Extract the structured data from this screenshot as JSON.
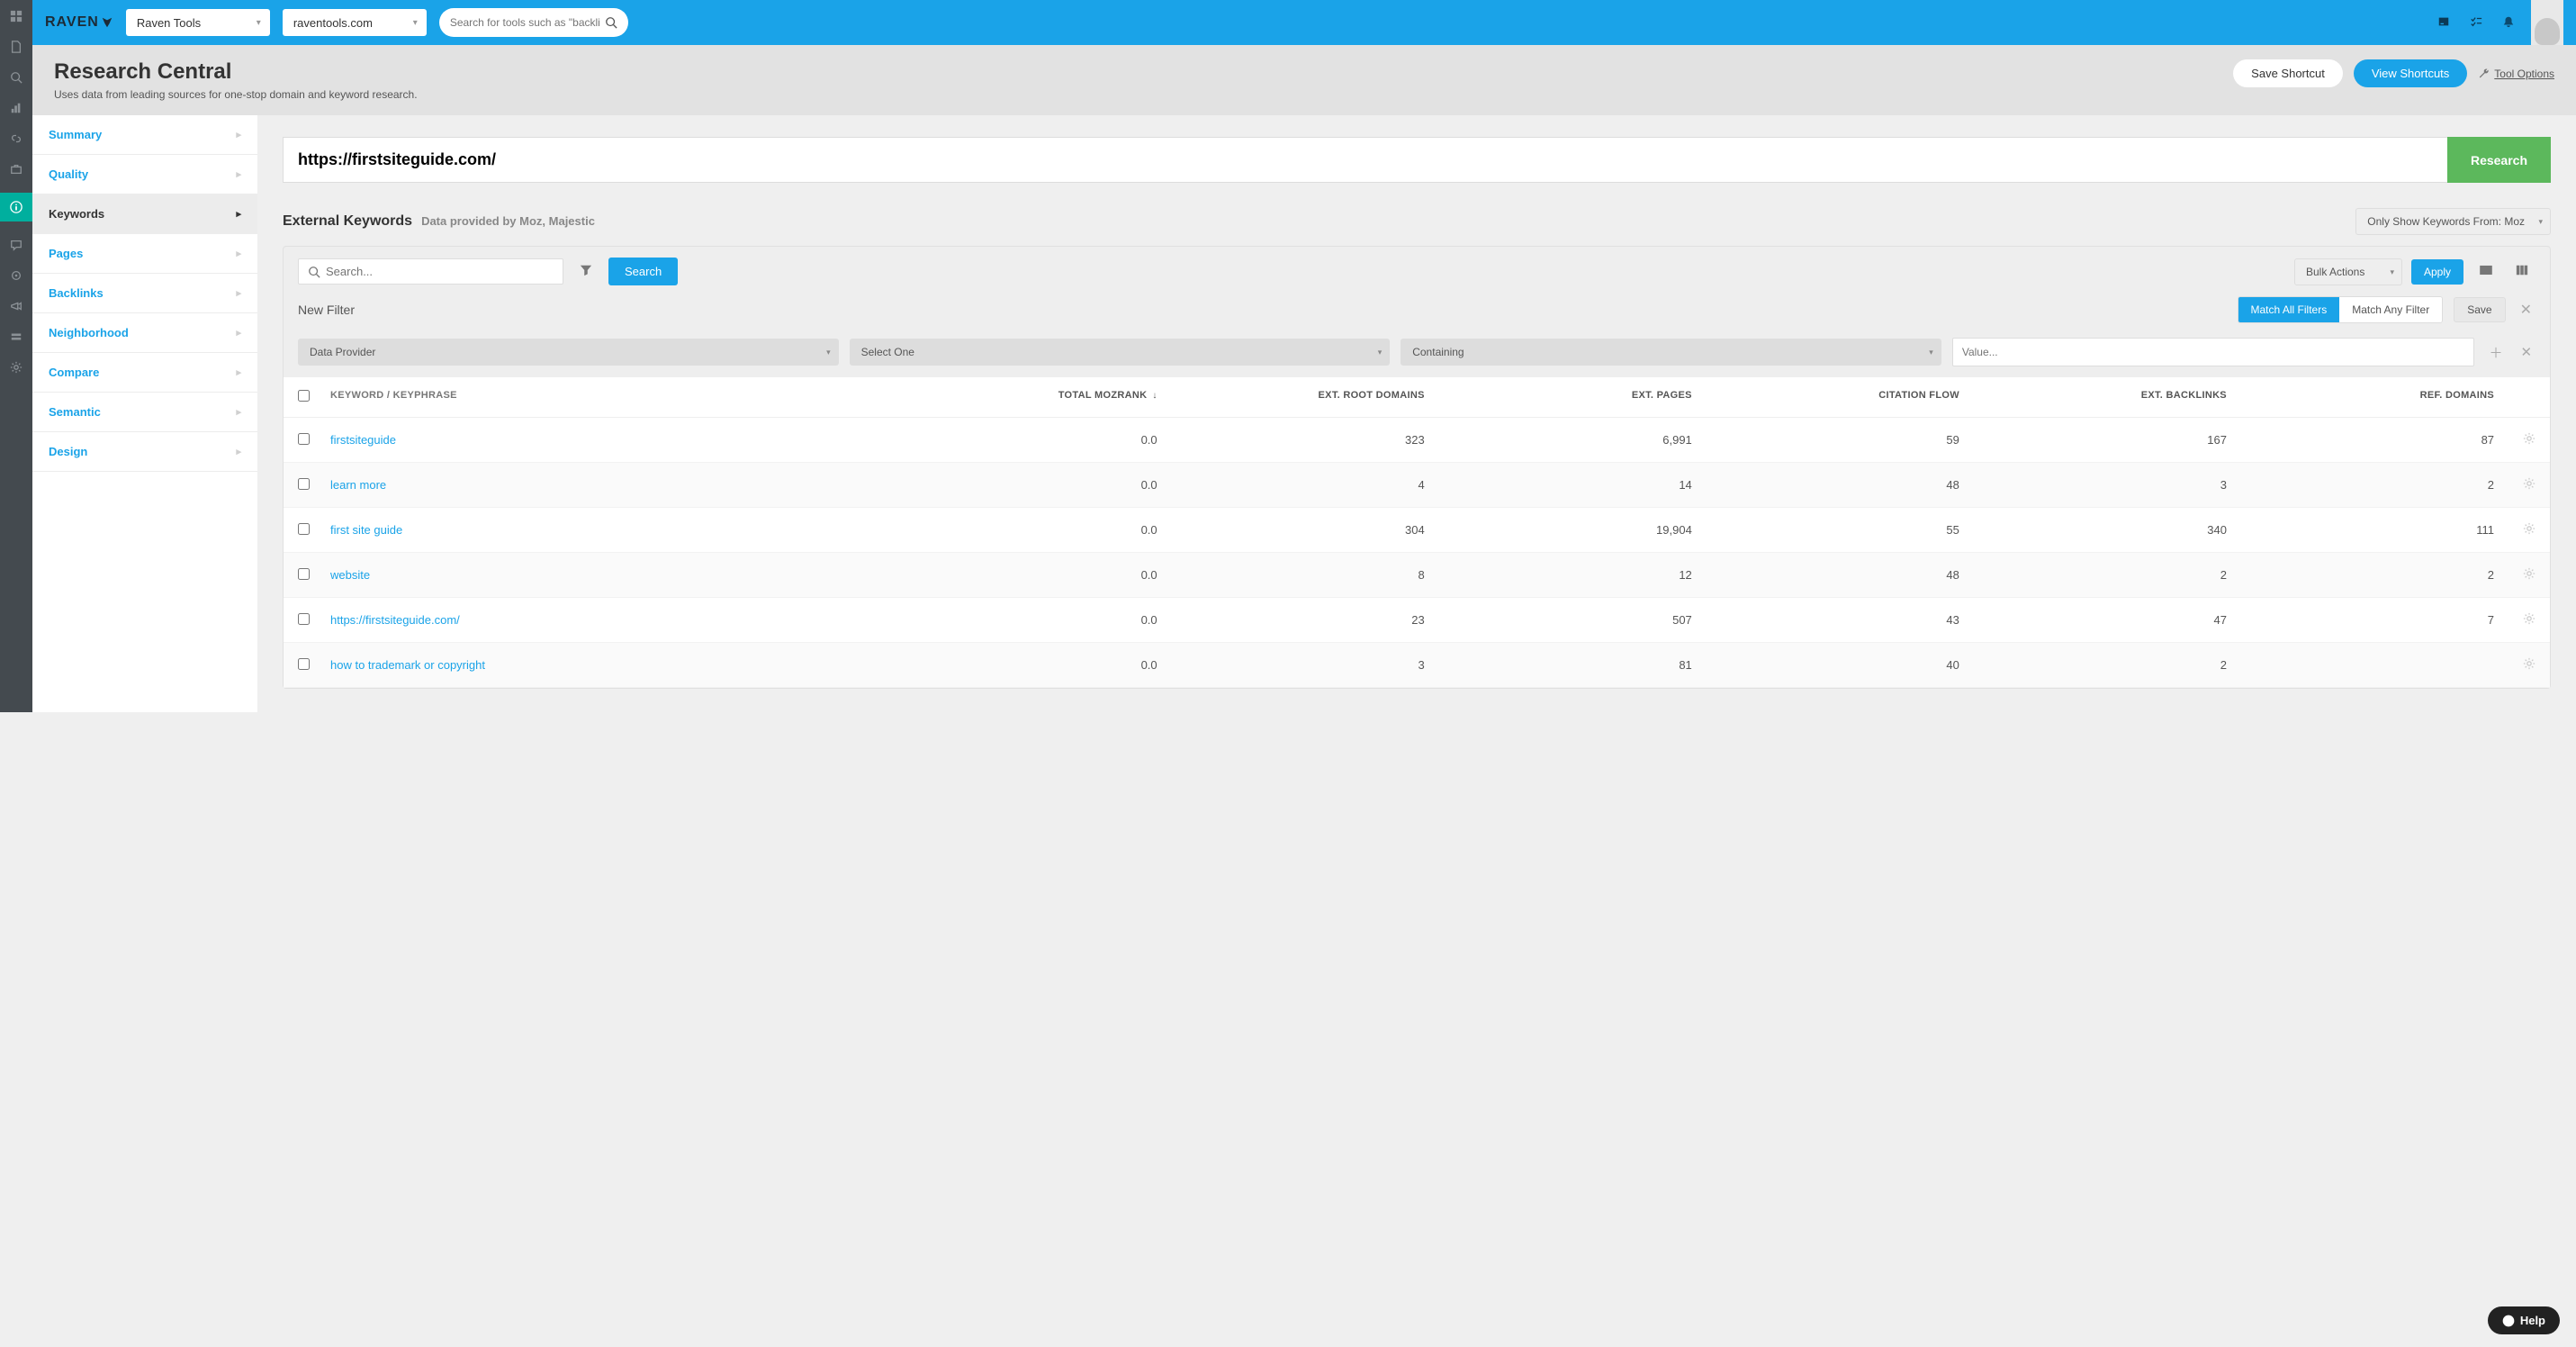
{
  "topbar": {
    "logo_text": "RAVEN",
    "account_select": "Raven Tools",
    "domain_select": "raventools.com",
    "search_placeholder": "Search for tools such as \"backlinks\""
  },
  "page_header": {
    "title": "Research Central",
    "subtitle": "Uses data from leading sources for one-stop domain and keyword research.",
    "save_shortcut": "Save Shortcut",
    "view_shortcuts": "View Shortcuts",
    "tool_options": "Tool Options"
  },
  "sidenav": {
    "items": [
      {
        "label": "Summary"
      },
      {
        "label": "Quality"
      },
      {
        "label": "Keywords",
        "active": true
      },
      {
        "label": "Pages"
      },
      {
        "label": "Backlinks"
      },
      {
        "label": "Neighborhood"
      },
      {
        "label": "Compare"
      },
      {
        "label": "Semantic"
      },
      {
        "label": "Design"
      }
    ]
  },
  "url_bar": {
    "value": "https://firstsiteguide.com/",
    "button": "Research"
  },
  "section": {
    "title": "External Keywords",
    "provider": "Data provided by Moz, Majestic",
    "show_from": "Only Show Keywords From: Moz"
  },
  "panel": {
    "search_placeholder": "Search...",
    "search_btn": "Search",
    "bulk_actions": "Bulk Actions",
    "apply": "Apply",
    "new_filter": "New Filter",
    "match_all": "Match All Filters",
    "match_any": "Match Any Filter",
    "save": "Save",
    "filter_provider": "Data Provider",
    "filter_select_one": "Select One",
    "filter_containing": "Containing",
    "filter_value_placeholder": "Value..."
  },
  "table": {
    "headers": {
      "keyword": "KEYWORD / KEYPHRASE",
      "mozrank": "TOTAL MOZRANK",
      "root_domains": "EXT. ROOT DOMAINS",
      "ext_pages": "EXT. PAGES",
      "citation_flow": "CITATION FLOW",
      "ext_backlinks": "EXT. BACKLINKS",
      "ref_domains": "REF. DOMAINS"
    },
    "rows": [
      {
        "kw": "firstsiteguide",
        "moz": "0.0",
        "root": "323",
        "pages": "6,991",
        "cf": "59",
        "bl": "167",
        "rd": "87"
      },
      {
        "kw": "learn more",
        "moz": "0.0",
        "root": "4",
        "pages": "14",
        "cf": "48",
        "bl": "3",
        "rd": "2"
      },
      {
        "kw": "first site guide",
        "moz": "0.0",
        "root": "304",
        "pages": "19,904",
        "cf": "55",
        "bl": "340",
        "rd": "111"
      },
      {
        "kw": "website",
        "moz": "0.0",
        "root": "8",
        "pages": "12",
        "cf": "48",
        "bl": "2",
        "rd": "2"
      },
      {
        "kw": "https://firstsiteguide.com/",
        "moz": "0.0",
        "root": "23",
        "pages": "507",
        "cf": "43",
        "bl": "47",
        "rd": "7"
      },
      {
        "kw": "how to trademark or copyright",
        "moz": "0.0",
        "root": "3",
        "pages": "81",
        "cf": "40",
        "bl": "2",
        "rd": ""
      }
    ]
  },
  "help": "Help"
}
